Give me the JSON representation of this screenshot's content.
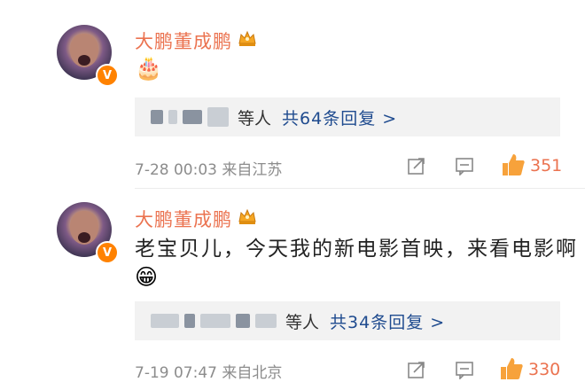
{
  "comments": [
    {
      "author": "大鹏董成鹏",
      "avatar_badge": "V",
      "text": "",
      "emoji": "🎂",
      "reply_others": "等人",
      "reply_link": "共64条回复 >",
      "time": "7-28 00:03",
      "source": "来自江苏",
      "likes": "351"
    },
    {
      "author": "大鹏董成鹏",
      "avatar_badge": "V",
      "text": "老宝贝儿，今天我的新电影首映，来看电影啊",
      "emoji": "😁",
      "reply_others": "等人",
      "reply_link": "共34条回复 >",
      "time": "7-19 07:47",
      "source": "来自北京",
      "likes": "330"
    }
  ],
  "icons": {
    "crown": "crown-badge-icon",
    "share": "share-icon",
    "comment": "comment-icon",
    "like": "thumbs-up-icon"
  },
  "colors": {
    "name": "#eb7350",
    "link": "#1f4b8f",
    "like": "#eb7350",
    "meta": "#8c8c8c",
    "reply_bg": "#f2f2f2"
  }
}
